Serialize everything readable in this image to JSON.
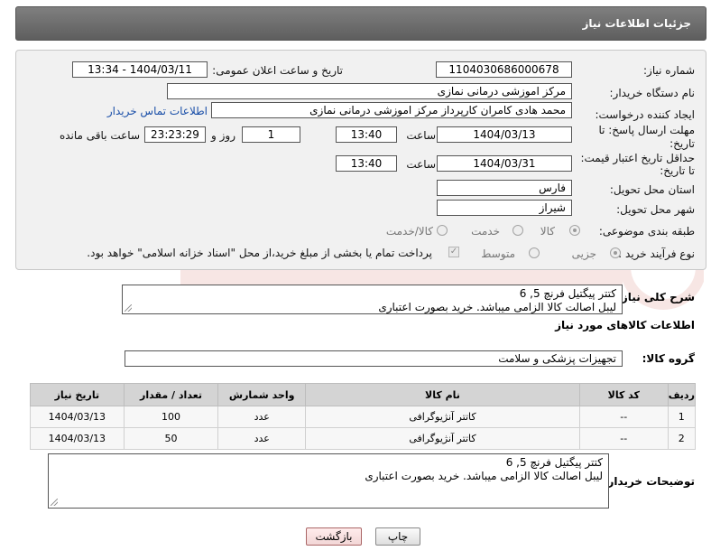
{
  "header": {
    "title": "جزئیات اطلاعات نیاز"
  },
  "form": {
    "need_number_label": "شماره نیاز:",
    "need_number": "1104030686000678",
    "announce_label": "تاریخ و ساعت اعلان عمومی:",
    "announce_value": "1404/03/11 - 13:34",
    "buyer_org_label": "نام دستگاه خریدار:",
    "buyer_org": "مرکز اموزشی درمانی نمازی",
    "creator_label": "ایجاد کننده درخواست:",
    "creator": "محمد هادی کامران کارپرداز مرکز اموزشی درمانی نمازی",
    "contact_link": "اطلاعات تماس خریدار",
    "reply_deadline_label_1": "مهلت ارسال پاسخ: تا",
    "reply_deadline_label_2": "تاریخ:",
    "reply_date": "1404/03/13",
    "time_label": "ساعت",
    "reply_time": "13:40",
    "days_value": "1",
    "days_label": "روز و",
    "remaining_time": "23:23:29",
    "remaining_label": "ساعت باقی مانده",
    "price_deadline_label_1": "حداقل تاریخ اعتبار قیمت:",
    "price_deadline_label_2": "تا تاریخ:",
    "price_date": "1404/03/31",
    "price_time": "13:40",
    "province_label": "استان محل تحویل:",
    "province": "فارس",
    "city_label": "شهر محل تحویل:",
    "city": "شیراز",
    "category_label": "طبقه بندی موضوعی:",
    "category_options": [
      "کالا",
      "خدمت",
      "کالا/خدمت"
    ],
    "process_label": "نوع فرآیند خرید :",
    "process_options": [
      "جزیی",
      "متوسط"
    ],
    "payment_note": "پرداخت تمام یا بخشی از مبلغ خرید،از محل \"اسناد خزانه اسلامی\" خواهد بود."
  },
  "summary": {
    "label": "شرح کلی نیاز:",
    "line1": "کتتر پیگتیل فرنچ 5, 6",
    "line2": "لیبل اصالت کالا الزامی میباشد. خرید بصورت اعتباری"
  },
  "goods": {
    "section_title": "اطلاعات کالاهای مورد نیاز",
    "group_label": "گروه کالا:",
    "group_value": "تجهیزات پزشکی و سلامت",
    "columns": [
      "ردیف",
      "کد کالا",
      "نام کالا",
      "واحد شمارش",
      "تعداد / مقدار",
      "تاریخ نیاز"
    ],
    "rows": [
      {
        "index": "1",
        "code": "--",
        "name": "کاتتر آنژیوگرافی",
        "unit": "عدد",
        "qty": "100",
        "date": "1404/03/13"
      },
      {
        "index": "2",
        "code": "--",
        "name": "کاتتر آنژیوگرافی",
        "unit": "عدد",
        "qty": "50",
        "date": "1404/03/13"
      }
    ]
  },
  "buyer_notes": {
    "label": "توضیحات خریدار:",
    "line1": "کتتر پیگتیل فرنچ 5, 6",
    "line2": "لیبل اصالت کالا الزامی میباشد. خرید بصورت اعتباری"
  },
  "buttons": {
    "print": "چاپ",
    "back": "بازگشت"
  },
  "colors": {
    "header_bg": "#6e6e6e",
    "panel_bg": "#f1f1f1",
    "link": "#1a4fa8",
    "table_header": "#d4d4d4"
  }
}
